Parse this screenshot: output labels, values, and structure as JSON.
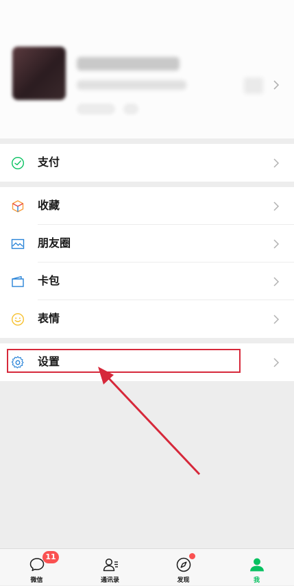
{
  "menu": {
    "pay": "支付",
    "favorites": "收藏",
    "moments": "朋友圈",
    "cards": "卡包",
    "stickers": "表情",
    "settings": "设置"
  },
  "tabbar": {
    "chats": "微信",
    "contacts": "通讯录",
    "discover": "发现",
    "me": "我",
    "chats_badge": "11"
  },
  "colors": {
    "accent_green": "#07c160",
    "badge_red": "#fa5151",
    "annotation_red": "#d6283a"
  }
}
